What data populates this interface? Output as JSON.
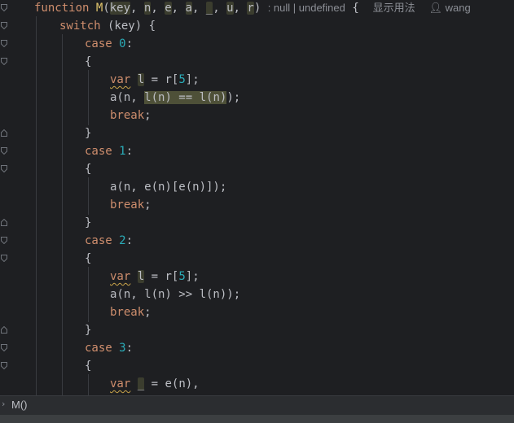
{
  "code": {
    "function_kw": "function",
    "function_name": "M",
    "open_paren": "(",
    "params": [
      "key",
      "n",
      "e",
      "a",
      "_",
      "u",
      "r"
    ],
    "close_paren": ")",
    "return_hint": ": null | undefined",
    "open_brace": "{",
    "usage_hint": "显示用法",
    "author": "wang",
    "switch_kw": "switch",
    "switch_arg": " (key) {",
    "case_kw": "case",
    "case0": "0",
    "case1": "1",
    "case2": "2",
    "case3": "3",
    "colon": ":",
    "lbrace": "{",
    "rbrace": "}",
    "var_kw": "var",
    "var_l": "l",
    "var_us": "_",
    "assign_r5_a": " = r[",
    "five": "5",
    "assign_r5_b": "];",
    "a_call_open": "a(n, ",
    "eq_expr": "l(n) == l(n)",
    "close_semi": ");",
    "case1_expr": "a(n, e(n)[e(n)]);",
    "case2_expr": "a(n, l(n) >> l(n));",
    "break_kw": "break",
    "semi": ";",
    "assign_en": " = e(n),"
  },
  "breadcrumb": {
    "chevron": "›",
    "text": "M()"
  },
  "colors": {
    "background": "#1e1f22",
    "keyword": "#cf8e6d",
    "function_highlight": "#e0c46c",
    "number": "#2aacb8",
    "text": "#bcbec4",
    "hint": "#8c8f96",
    "usage_highlight": "#4e5038"
  },
  "icons": [
    "user-icon",
    "fold-marker-icon",
    "chevron-right-icon"
  ]
}
